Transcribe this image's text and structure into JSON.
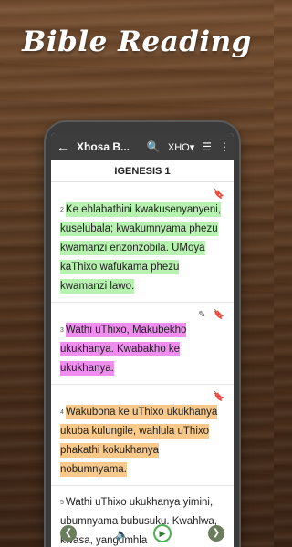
{
  "headline": "Bible Reading",
  "appbar": {
    "back_icon": "arrow-left-icon",
    "title": "Xhosa B...",
    "search_icon": "search-icon",
    "language": "XHO▾",
    "list_icon": "list-icon",
    "menu_icon": "more-vert-icon"
  },
  "chapter_title": "IGENESIS 1",
  "verses": [
    {
      "num": "2",
      "text": "Ke ehlabathini kwakusenyanyeni, kuselubala; kwakumnyama phezu kwamanzi enzonzobila. UMoya kaThixo wafukama phezu kwamanzi lawo.",
      "color": "#b7f2b0"
    },
    {
      "num": "3",
      "text": "Wathi uThixo, Makubekho ukukhanya. Kwabakho ke ukukhanya.",
      "color": "#f08ef0"
    },
    {
      "num": "4",
      "text": "Wakubona ke uThixo ukukhanya ukuba kulungile, wahlula uThixo phakathi kokukhanya nobumnyama.",
      "color": "#f8c98a"
    },
    {
      "num": "5",
      "text": "Wathi uThixo ukukhanya yimini, ubumnyama bubusuku. Kwahlwa, kwasa, yangumhla"
    }
  ]
}
